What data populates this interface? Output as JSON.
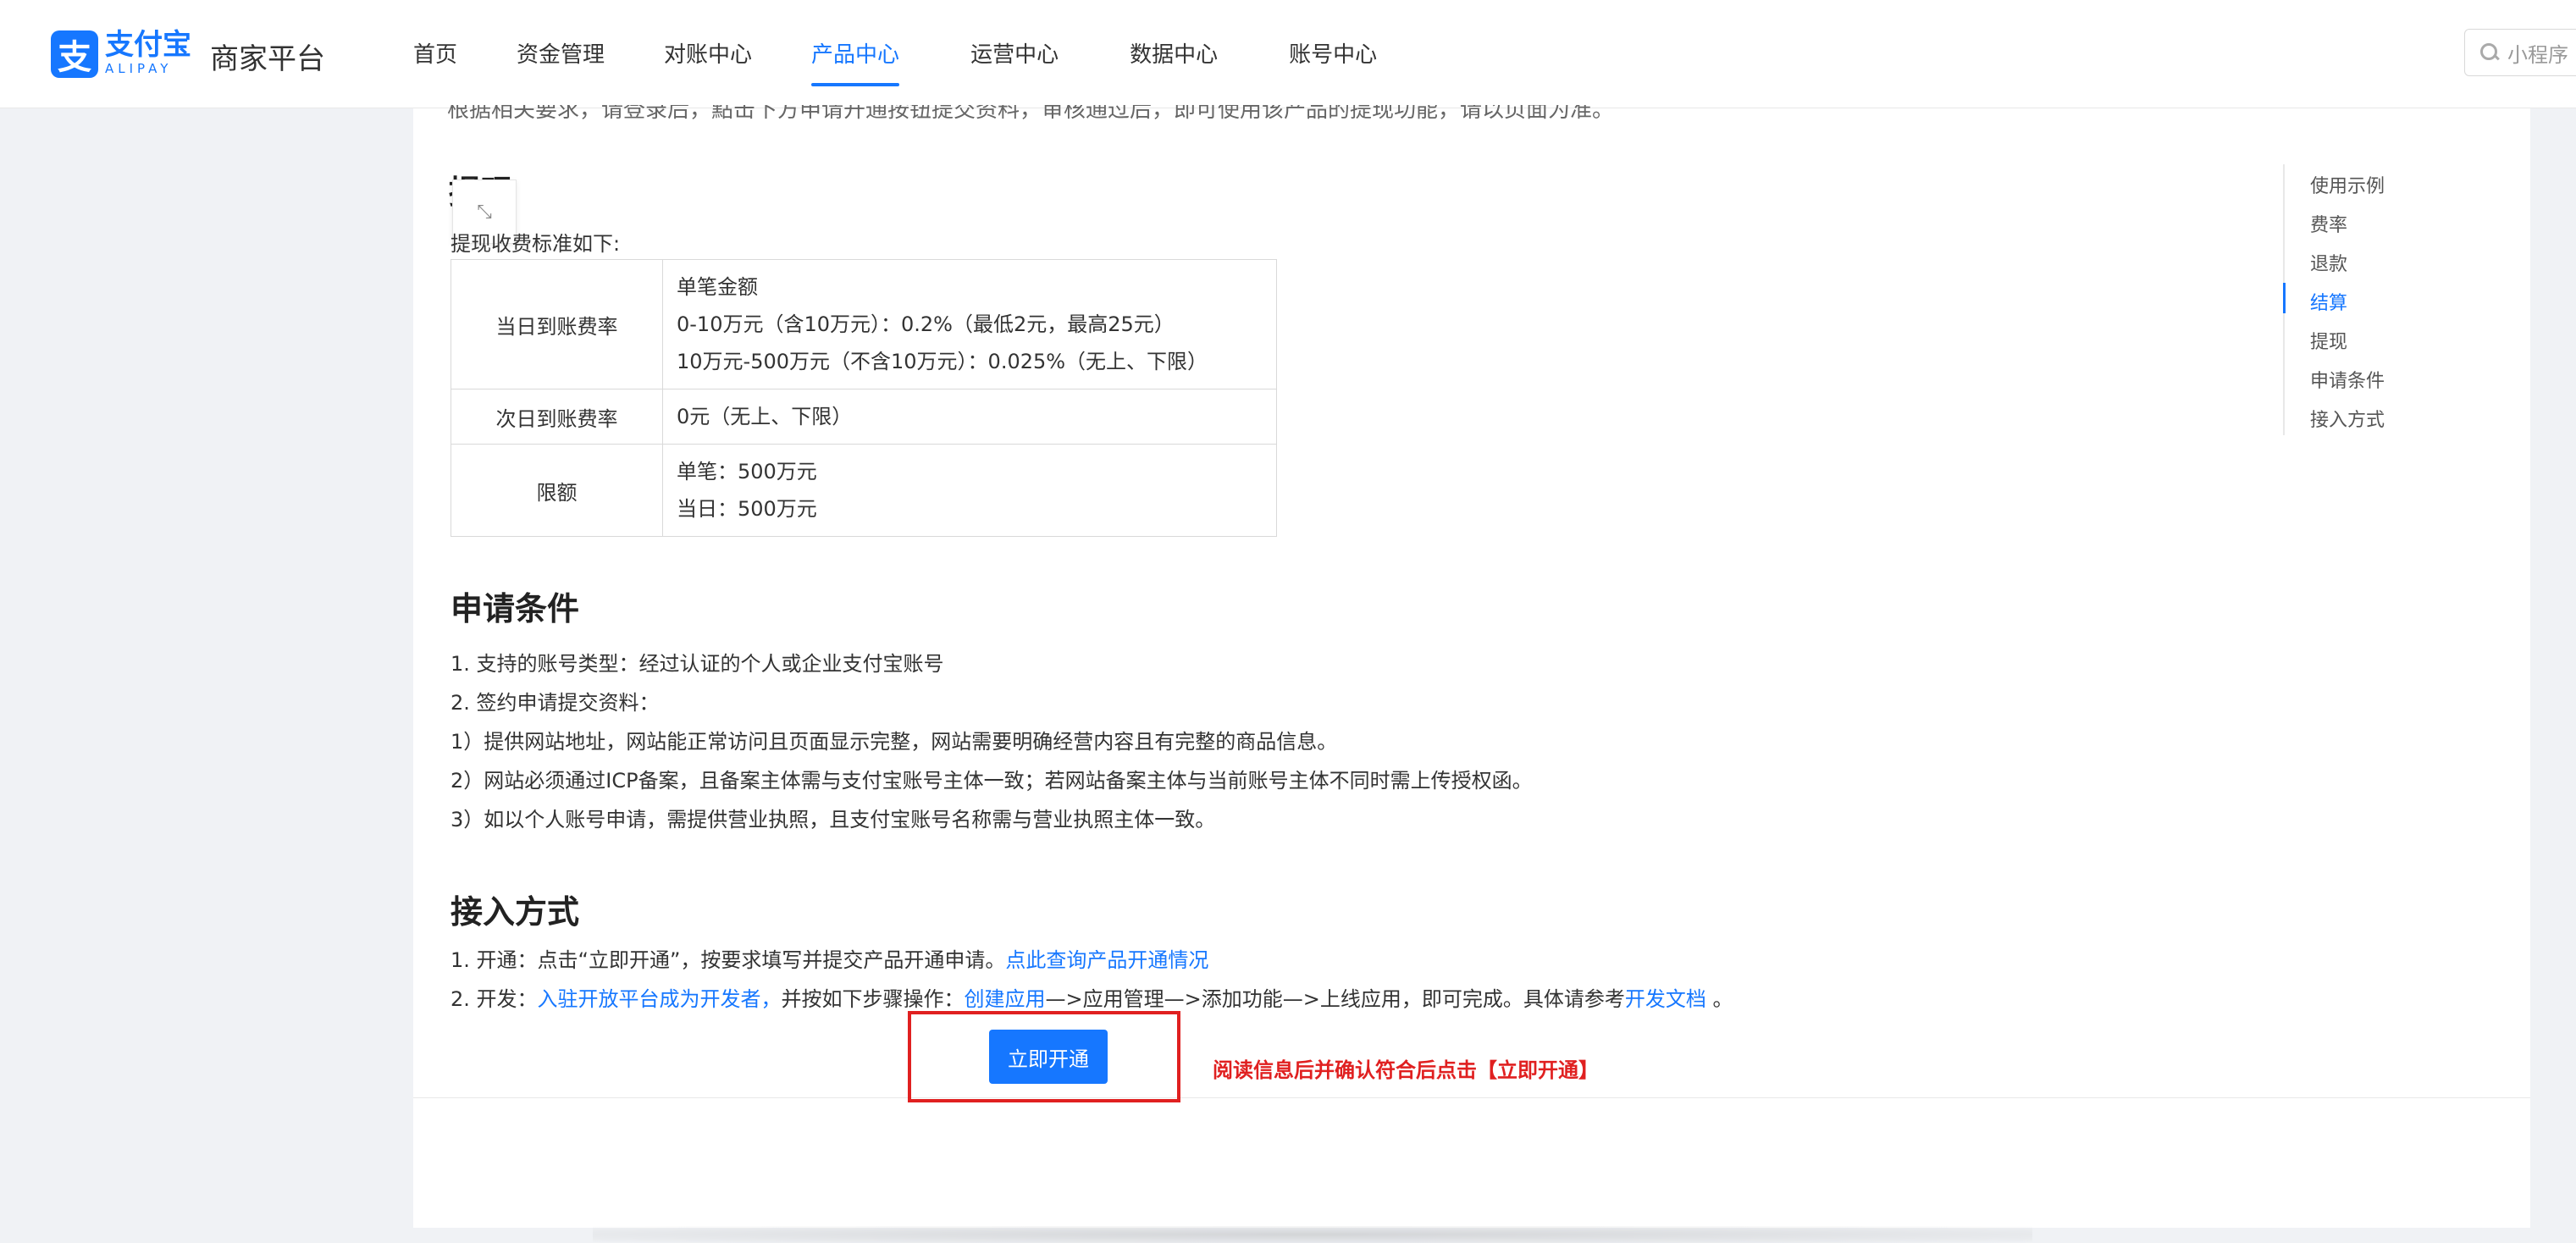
{
  "header": {
    "logo_glyph": "支",
    "logo_cn": "支付宝",
    "logo_en": "ALIPAY",
    "platform": "商家平台",
    "nav": [
      {
        "label": "首页",
        "active": false
      },
      {
        "label": "资金管理",
        "active": false
      },
      {
        "label": "对账中心",
        "active": false
      },
      {
        "label": "产品中心",
        "active": true
      },
      {
        "label": "运营中心",
        "active": false
      },
      {
        "label": "数据中心",
        "active": false
      },
      {
        "label": "账号中心",
        "active": false
      }
    ],
    "search_placeholder": "小程序"
  },
  "content": {
    "cut_top_text": "根据相关要求，请登录后，點击下方申请开通按钮提交资料，审核通过后，即可使用该产品的提现功能，请以页面为准。",
    "withdraw_heading_cut": "提现",
    "fee_intro": "提现收费标准如下:",
    "fee_table": [
      {
        "label": "当日到账费率",
        "lines": [
          "单笔金额",
          "0-10万元（含10万元）：0.2%（最低2元，最高25元）",
          "10万元-500万元（不含10万元）：0.025%（无上、下限）"
        ]
      },
      {
        "label": "次日到账费率",
        "lines": [
          "0元（无上、下限）"
        ]
      },
      {
        "label": "限额",
        "lines": [
          "单笔：500万元",
          "当日：500万元"
        ]
      }
    ],
    "conditions_title": "申请条件",
    "conditions": [
      "1.  支持的账号类型：经过认证的个人或企业支付宝账号",
      "2.  签约申请提交资料：",
      "1）提供网站地址，网站能正常访问且页面显示完整，网站需要明确经营内容且有完整的商品信息。",
      "2）网站必须通过ICP备案，且备案主体需与支付宝账号主体一致；若网站备案主体与当前账号主体不同时需上传授权函。",
      "3）如以个人账号申请，需提供营业执照，且支付宝账号名称需与营业执照主体一致。"
    ],
    "access_title": "接入方式",
    "access_line1": {
      "prefix": "1. 开通：点击“立即开通”，按要求填写并提交产品开通申请。",
      "link": "点此查询产品开通情况"
    },
    "access_line2": {
      "prefix": "2. 开发：",
      "link1": "入驻开放平台成为开发者，",
      "mid": "并按如下步骤操作：",
      "link2": "创建应用",
      "mid2": "—>应用管理—>添加功能—>上线应用，即可完成。具体请参考",
      "link3": "开发文档",
      "suffix": " 。"
    }
  },
  "anchor_nav": [
    {
      "label": "使用示例",
      "active": false
    },
    {
      "label": "费率",
      "active": false
    },
    {
      "label": "退款",
      "active": false
    },
    {
      "label": "结算",
      "active": true
    },
    {
      "label": "提现",
      "active": false
    },
    {
      "label": "申请条件",
      "active": false
    },
    {
      "label": "接入方式",
      "active": false
    }
  ],
  "footer": {
    "open_button": "立即开通",
    "tip": "阅读信息后并确认符合后点击【立即开通】"
  },
  "colors": {
    "brand": "#1677ff",
    "alert": "#e02020"
  }
}
